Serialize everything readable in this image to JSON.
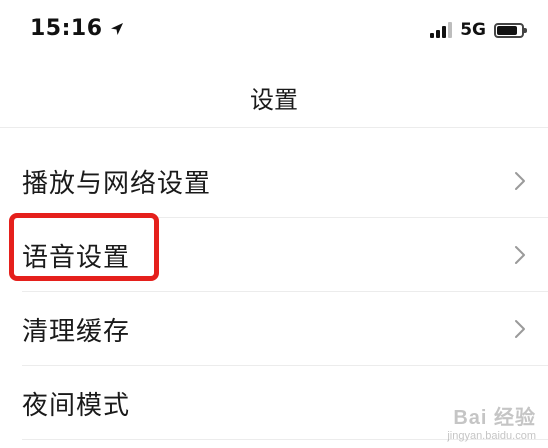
{
  "status_bar": {
    "time": "15:16",
    "network": "5G",
    "battery_level": 0.85,
    "signal_bars_active": 3,
    "signal_bars_total": 4
  },
  "nav": {
    "title": "设置"
  },
  "settings": {
    "items": [
      {
        "label": "播放与网络设置"
      },
      {
        "label": "语音设置",
        "highlighted": true
      },
      {
        "label": "清理缓存"
      },
      {
        "label": "夜间模式"
      }
    ]
  },
  "annotation": {
    "highlight_color": "#e5201c"
  },
  "watermark": {
    "main": "Bai 经验",
    "sub": "jingyan.baidu.com"
  }
}
